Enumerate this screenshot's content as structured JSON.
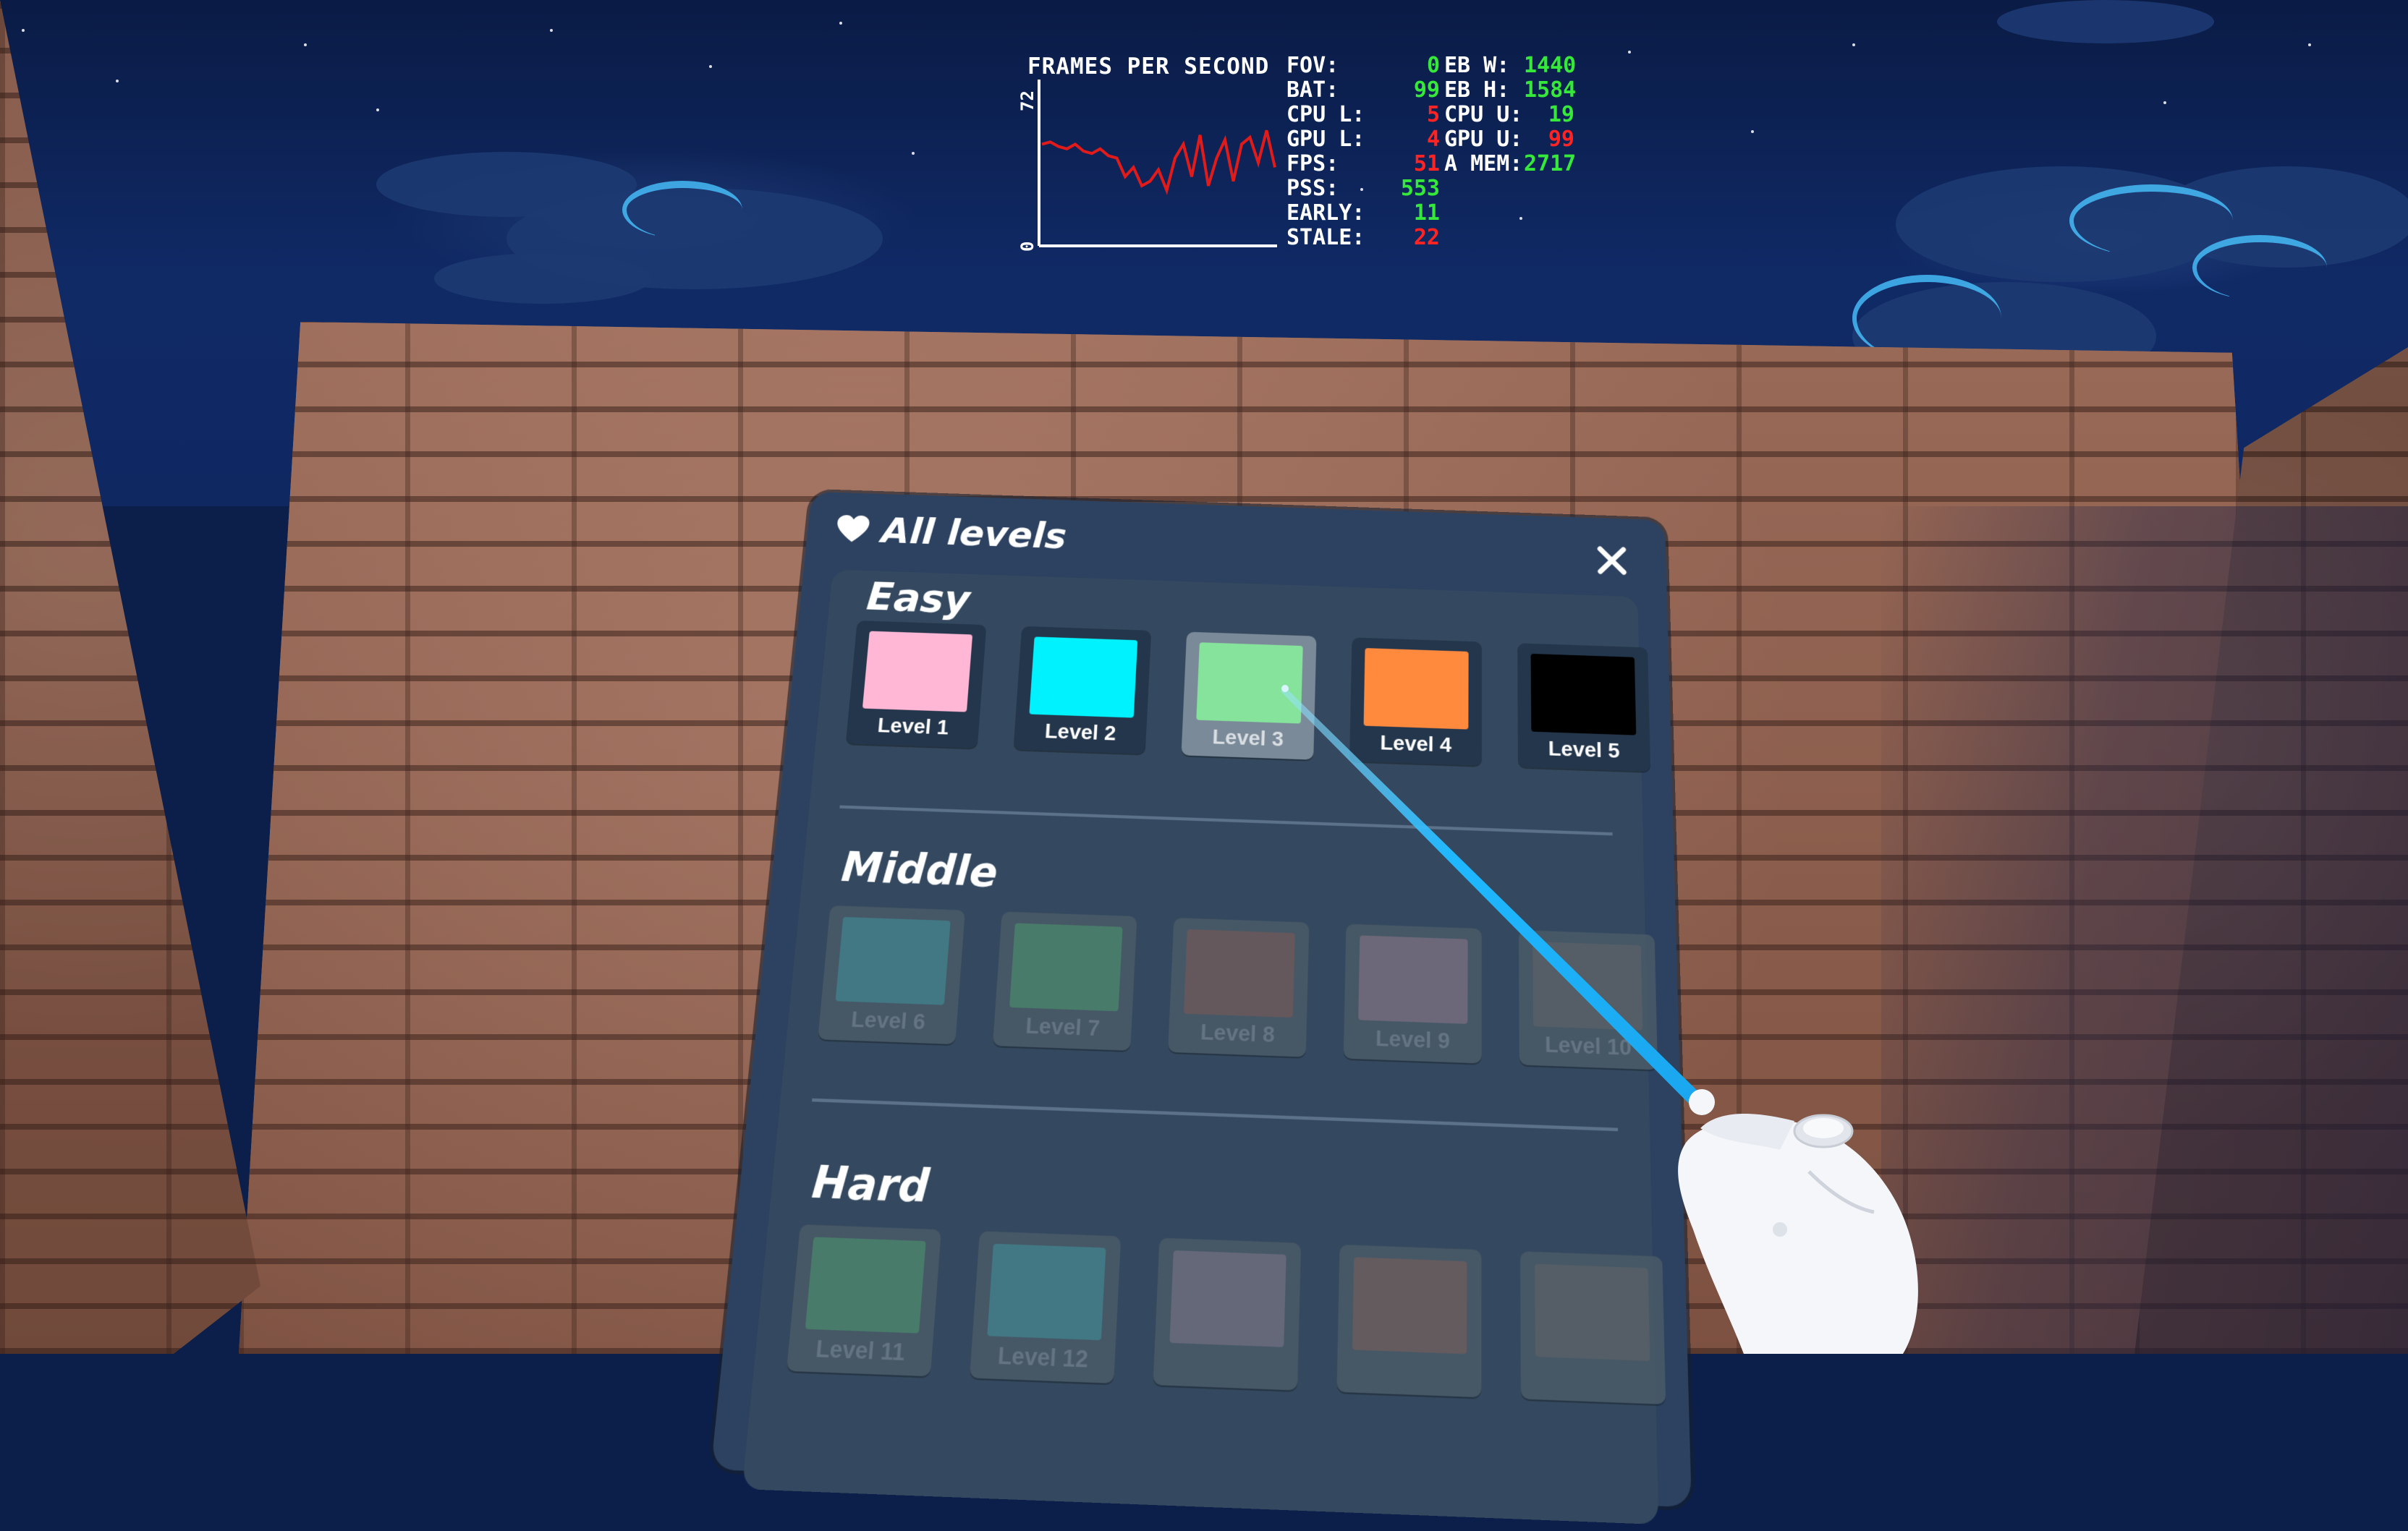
{
  "hud": {
    "title": "FRAMES PER SECOND",
    "graph_max": "72",
    "graph_min": "0",
    "fps_series": [
      44,
      45,
      43,
      42,
      44,
      41,
      40,
      42,
      39,
      38,
      30,
      34,
      26,
      28,
      33,
      24,
      38,
      44,
      30,
      48,
      26,
      38,
      46,
      28,
      44,
      47,
      36,
      50,
      34
    ],
    "stats": [
      {
        "key": "FOV:",
        "val": "0",
        "val_color": "green",
        "key2": "EB W:",
        "val2": "1440",
        "val2_color": "green"
      },
      {
        "key": "BAT:",
        "val": "99",
        "val_color": "green",
        "key2": "EB H:",
        "val2": "1584",
        "val2_color": "green"
      },
      {
        "key": "CPU L:",
        "val": "5",
        "val_color": "red",
        "key2": "CPU U:",
        "val2": "19",
        "val2_color": "green"
      },
      {
        "key": "GPU L:",
        "val": "4",
        "val_color": "red",
        "key2": "GPU U:",
        "val2": "99",
        "val2_color": "red"
      },
      {
        "key": "FPS:",
        "val": "51",
        "val_color": "red",
        "key2": "A MEM:",
        "val2": "2717",
        "val2_color": "green"
      },
      {
        "key": "PSS:",
        "val": "553",
        "val_color": "green",
        "key2": "",
        "val2": "",
        "val2_color": "green"
      },
      {
        "key": "EARLY:",
        "val": "11",
        "val_color": "green",
        "key2": "",
        "val2": "",
        "val2_color": "green"
      },
      {
        "key": "STALE:",
        "val": "22",
        "val_color": "red",
        "key2": "",
        "val2": "",
        "val2_color": "green"
      }
    ]
  },
  "panel": {
    "title": "All levels",
    "icon": "heart-icon",
    "close_icon": "close-icon",
    "sections": [
      {
        "title": "Easy",
        "levels": [
          {
            "label": "Level 1",
            "color": "#ffb7d5",
            "state": "unlocked"
          },
          {
            "label": "Level 2",
            "color": "#00f2ff",
            "state": "unlocked"
          },
          {
            "label": "Level 3",
            "color": "#86e39c",
            "state": "selected"
          },
          {
            "label": "Level 4",
            "color": "#ff8a3d",
            "state": "unlocked"
          },
          {
            "label": "Level 5",
            "color": "#000000",
            "state": "unlocked"
          }
        ]
      },
      {
        "title": "Middle",
        "levels": [
          {
            "label": "Level 6",
            "color": "#3fa3a8",
            "state": "locked"
          },
          {
            "label": "Level 7",
            "color": "#4fa86f",
            "state": "locked"
          },
          {
            "label": "Level 8",
            "color": "#8a5c52",
            "state": "locked"
          },
          {
            "label": "Level 9",
            "color": "#9a8090",
            "state": "locked"
          },
          {
            "label": "Level 10",
            "color": "#6a6a68",
            "state": "locked"
          }
        ]
      },
      {
        "title": "Hard",
        "levels": [
          {
            "label": "Level 11",
            "color": "#4fa86f",
            "state": "locked"
          },
          {
            "label": "Level 12",
            "color": "#3fa3a8",
            "state": "locked"
          },
          {
            "label": "",
            "color": "#8c8090",
            "state": "locked"
          },
          {
            "label": "",
            "color": "#8a6558",
            "state": "locked"
          },
          {
            "label": "",
            "color": "#6a6a68",
            "state": "locked"
          }
        ]
      }
    ]
  },
  "colors": {
    "panel_bg": "#2d4260",
    "hud_green": "#35e83a",
    "hud_red": "#ff2424",
    "pointer_ray": "#1fb8ff"
  }
}
